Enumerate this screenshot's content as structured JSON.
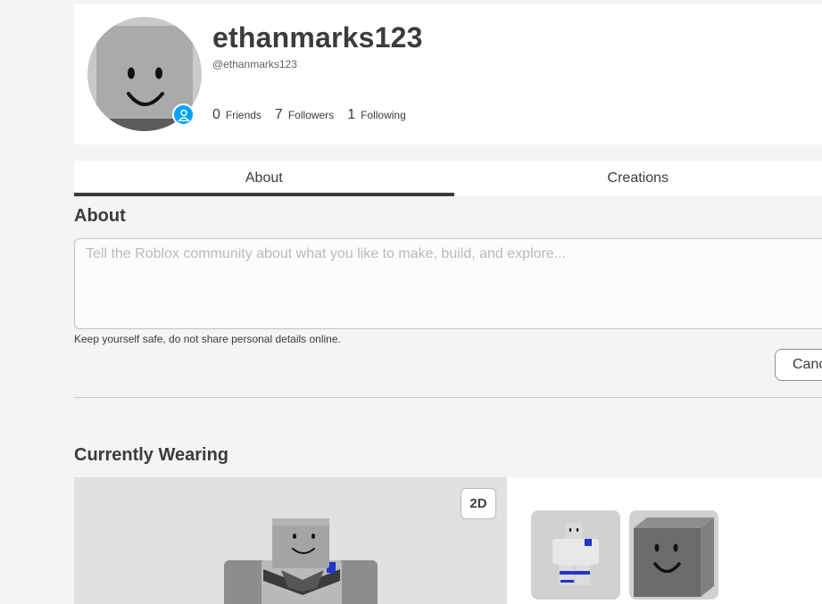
{
  "profile": {
    "display_name": "ethanmarks123",
    "handle": "@ethanmarks123",
    "presence": "online",
    "stats": [
      {
        "count": "0",
        "label": "Friends"
      },
      {
        "count": "7",
        "label": "Followers"
      },
      {
        "count": "1",
        "label": "Following"
      }
    ]
  },
  "tabs": [
    {
      "label": "About",
      "active": true
    },
    {
      "label": "Creations",
      "active": false
    }
  ],
  "about": {
    "title": "About",
    "placeholder": "Tell the Roblox community about what you like to make, build, and explore...",
    "value": "",
    "safety_note": "Keep yourself safe, do not share personal details online.",
    "cancel_label": "Cancel"
  },
  "wearing": {
    "title": "Currently Wearing",
    "view_toggle": "2D",
    "items": [
      {
        "icon": "shirt-item-icon"
      },
      {
        "icon": "smile-face-item-icon"
      }
    ]
  },
  "colors": {
    "accent": "#00a2ff",
    "text": "#393b3d",
    "background": "#f2f4f5"
  }
}
